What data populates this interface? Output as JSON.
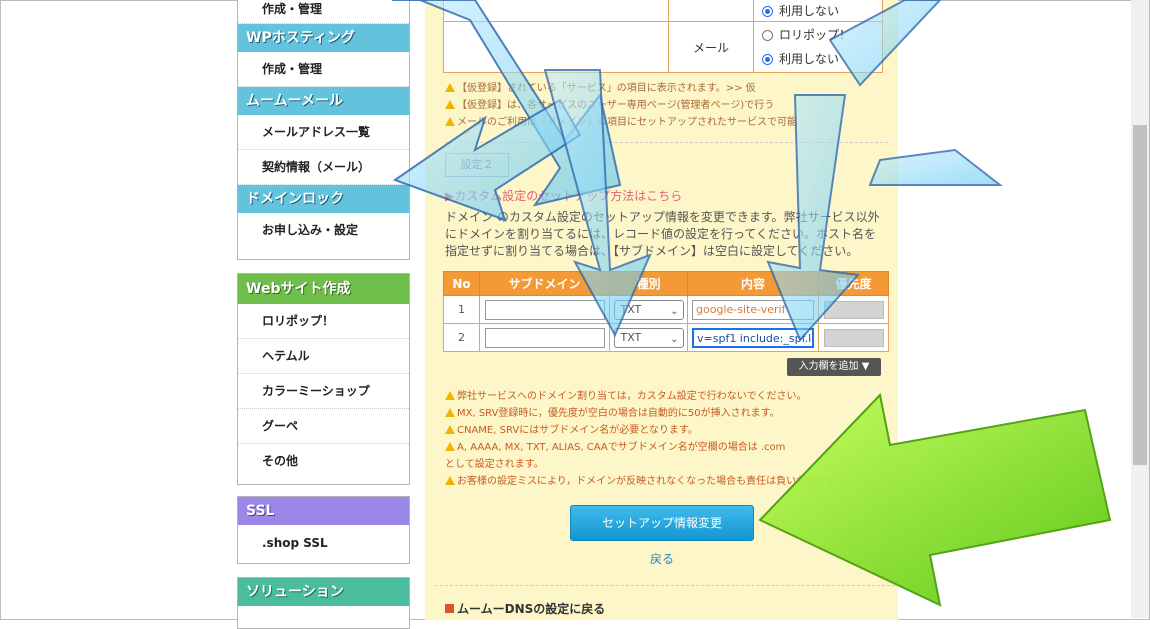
{
  "sidebar": {
    "top_item": "作成・管理",
    "wp_heading": "WPホスティング",
    "wp_item": "作成・管理",
    "mail_heading": "ムームーメール",
    "mail_items": [
      "メールアドレス一覧",
      "契約情報（メール）"
    ],
    "lock_heading": "ドメインロック",
    "lock_item": "お申し込み・設定",
    "web_heading": "Webサイト作成",
    "web_items": [
      "ロリポップ！",
      "ヘテムル",
      "カラーミーショップ",
      "グーペ",
      "その他"
    ],
    "ssl_heading": "SSL",
    "ssl_item": ".shop SSL",
    "solution_heading": "ソリューション"
  },
  "mail_table": {
    "label": "メール",
    "top_option": "利用しない",
    "options": [
      "ロリポップ！",
      "利用しない"
    ],
    "selected": "利用しない"
  },
  "notes": [
    "【仮登録】されている「サービス」の項目に表示されます。>> 仮",
    "【仮登録】は、各サービスのユーザー専用ページ(管理者ページ)で行う",
    "メールのご利用は「ドメイン」の項目にセットアップされたサービスで可能"
  ],
  "settings_tab": "設定２",
  "custom_link": "カスタム設定のセットアップ方法はこちら",
  "description": "ドメイン のカスタム設定のセットアップ情報を変更できます。弊社サービス以外にドメインを割り当てるには、レコード値の設定を行ってください。ホスト名を指定せずに割り当てる場合は、【サブドメイン】は空白に設定してください。",
  "dns_table": {
    "headers": [
      "No",
      "サブドメイン",
      "種別",
      "内容",
      "優先度"
    ],
    "rows": [
      {
        "no": "1",
        "subdomain": "",
        "type": "TXT",
        "content": "google-site-verif"
      },
      {
        "no": "2",
        "subdomain": "",
        "type": "TXT",
        "content": "v=spf1 include:_spf.l"
      }
    ]
  },
  "add_row_button": "入力欄を追加",
  "warnings": [
    "弊社サービスへのドメイン割り当ては，カスタム設定で行わないでください。",
    "MX, SRV登録時に，優先度が空白の場合は自動的に50が挿入されます。",
    "CNAME, SRVにはサブドメイン名が必要となります。",
    "A, AAAA, MX, TXT, ALIAS, CAAでサブドメイン名が空欄の場合は .com",
    "として設定されます。",
    "お客様の設定ミスにより，ドメインが反映されなくなった場合も責任は負いかねます。"
  ],
  "submit_button": "セットアップ情報変更",
  "back_link": "戻る",
  "footer_link": "ムームーDNSの設定に戻る",
  "colors": {
    "sidebar_blue": "#63c3dc",
    "sidebar_green": "#6fbd4a",
    "sidebar_purple": "#9a87e8",
    "sidebar_teal": "#4bbd9e",
    "table_header": "#f39a36",
    "panel_bg": "#fdf6c8",
    "submit_button": "#1ea3dc",
    "arrow_blue": "#7dd3f3",
    "arrow_green": "#7ee21a"
  }
}
